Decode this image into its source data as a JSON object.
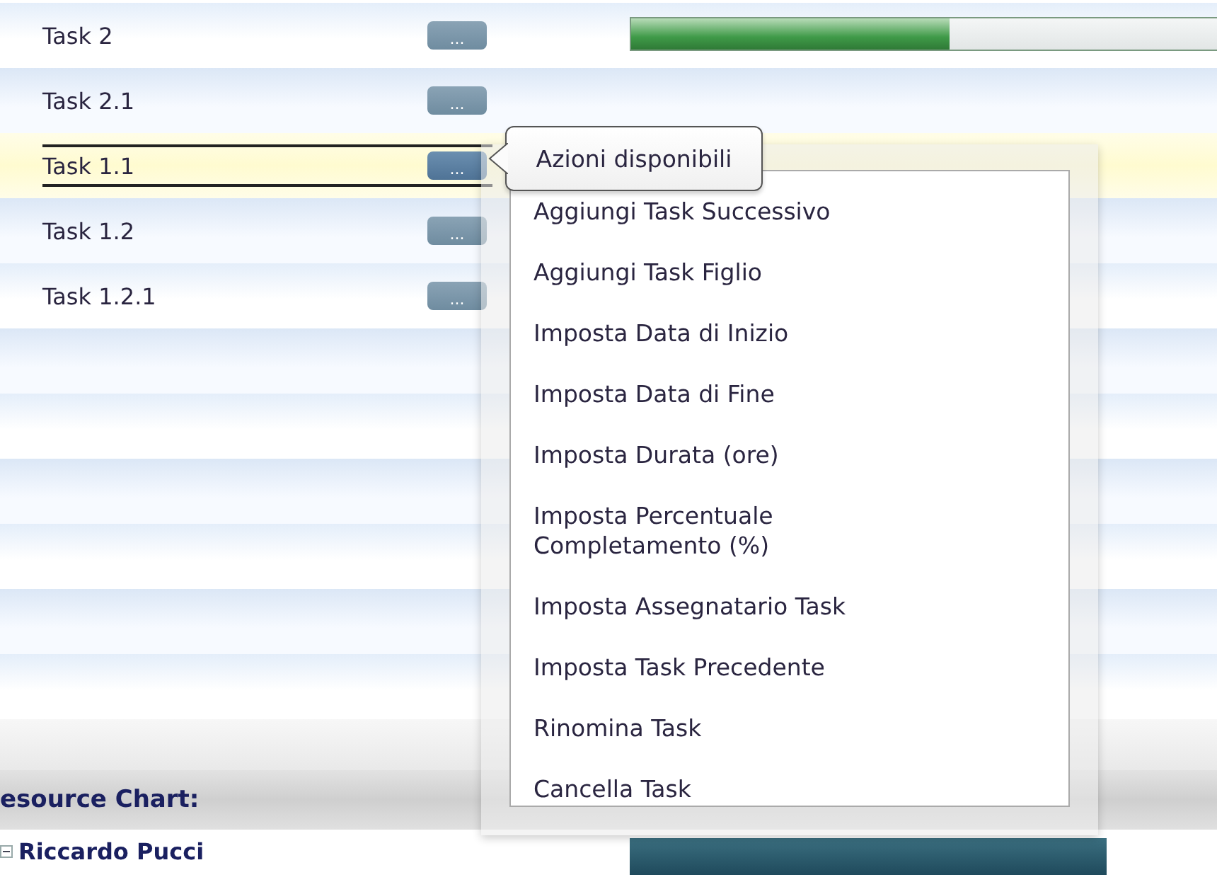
{
  "tasks": [
    {
      "name": "Task 2",
      "selected": false,
      "progress": {
        "level": 0.52
      }
    },
    {
      "name": "Task 2.1",
      "selected": false
    },
    {
      "name": "Task 1.1",
      "selected": true
    },
    {
      "name": "Task 1.2",
      "selected": false
    },
    {
      "name": "Task 1.2.1",
      "selected": false
    }
  ],
  "actions_tooltip": "Azioni disponibili",
  "actions_button": "...",
  "actions_menu": [
    "Aggiungi Task Successivo",
    "Aggiungi Task Figlio",
    "Imposta Data di Inizio",
    "Imposta Data di Fine",
    "Imposta Durata (ore)",
    "Imposta Percentuale Completamento (%)",
    "Imposta Assegnatario Task",
    "Imposta Task Precedente",
    "Rinomina Task",
    "Cancella Task"
  ],
  "resource_chart": {
    "title": "esource Chart:",
    "resources": [
      {
        "name": "Riccardo Pucci",
        "expanded": true
      }
    ]
  }
}
